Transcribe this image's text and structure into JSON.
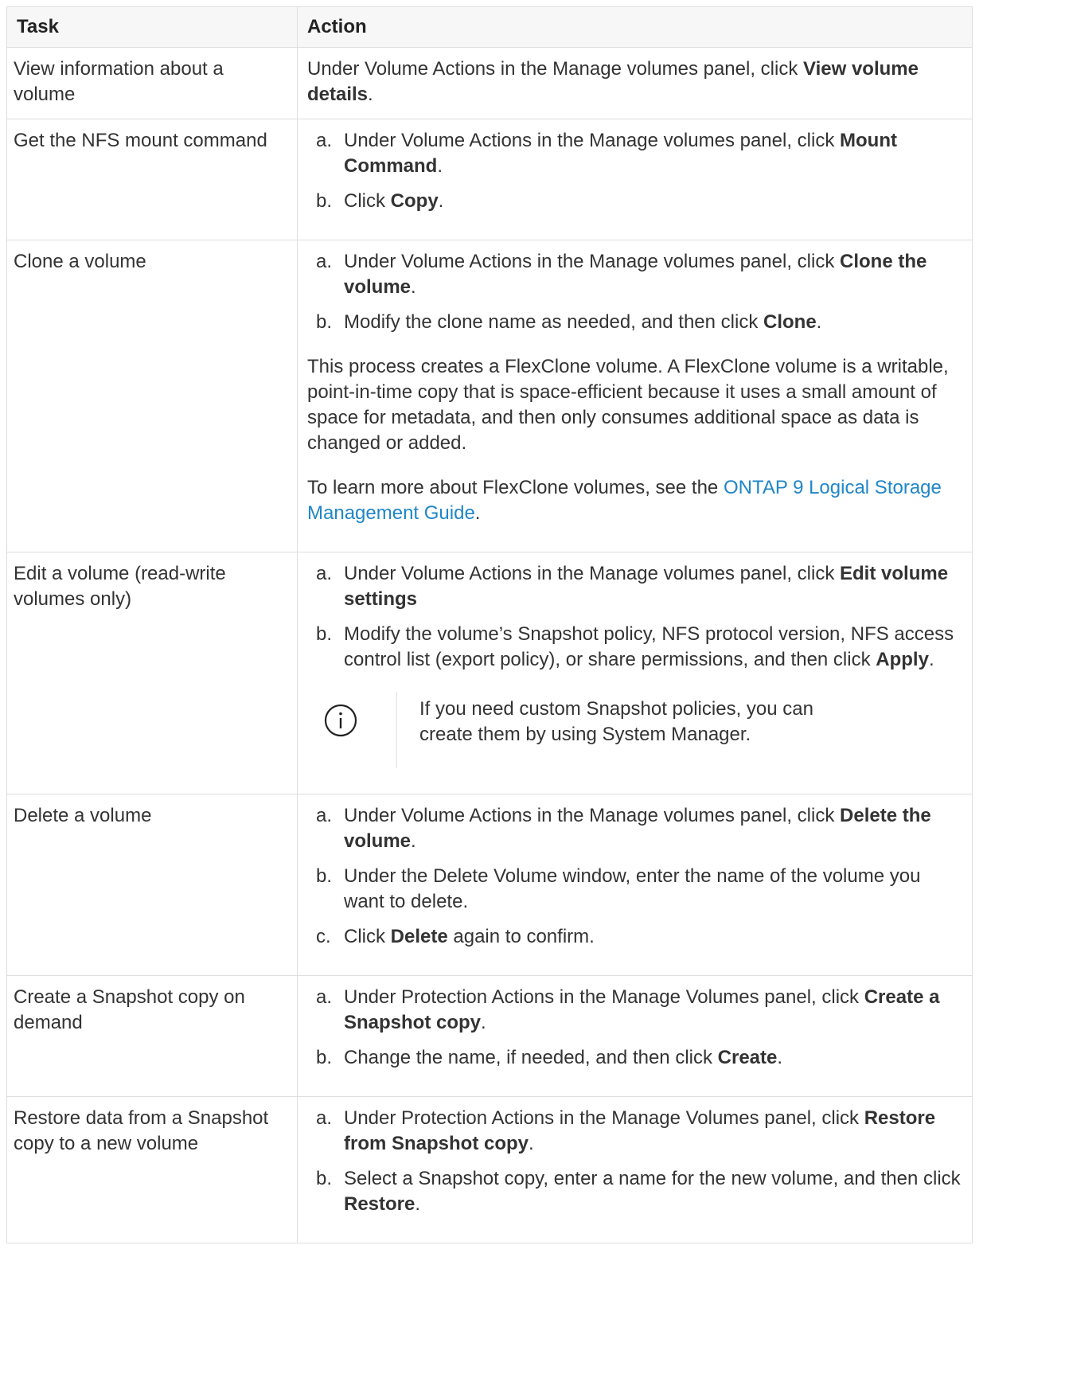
{
  "headers": {
    "task": "Task",
    "action": "Action"
  },
  "rows": [
    {
      "task": "View information about a volume",
      "action": {
        "pre": "Under Volume Actions in the Manage volumes panel, click ",
        "bold": "View volume details",
        "post": "."
      }
    },
    {
      "task": "Get the NFS mount command",
      "steps": [
        {
          "marker": "a.",
          "pre": "Under Volume Actions in the Manage volumes panel, click ",
          "bold": "Mount Command",
          "post": "."
        },
        {
          "marker": "b.",
          "pre": "Click ",
          "bold": "Copy",
          "post": "."
        }
      ]
    },
    {
      "task": "Clone a volume",
      "steps": [
        {
          "marker": "a.",
          "pre": "Under Volume Actions in the Manage volumes panel, click ",
          "bold": "Clone the volume",
          "post": "."
        },
        {
          "marker": "b.",
          "pre": "Modify the clone name as needed, and then click ",
          "bold": "Clone",
          "post": "."
        }
      ],
      "paragraph": "This process creates a FlexClone volume. A FlexClone volume is a writable, point-in-time copy that is space-efficient because it uses a small amount of space for metadata, and then only consumes additional space as data is changed or added.",
      "learn_more": {
        "pre": "To learn more about FlexClone volumes, see the ",
        "link": "ONTAP 9 Logical Storage Management Guide",
        "post": "."
      }
    },
    {
      "task": "Edit a volume (read-write volumes only)",
      "steps": [
        {
          "marker": "a.",
          "pre": "Under Volume Actions in the Manage volumes panel, click ",
          "bold": "Edit volume settings",
          "post": ""
        },
        {
          "marker": "b.",
          "pre": "Modify the volume’s Snapshot policy, NFS protocol version, NFS access control list (export policy), or share permissions, and then click ",
          "bold": "Apply",
          "post": "."
        }
      ],
      "note": {
        "icon": "info-icon",
        "text": "If you need custom Snapshot policies, you can create them by using System Manager."
      }
    },
    {
      "task": "Delete a volume",
      "steps": [
        {
          "marker": "a.",
          "pre": "Under Volume Actions in the Manage volumes panel, click ",
          "bold": "Delete the volume",
          "post": "."
        },
        {
          "marker": "b.",
          "pre": "Under the Delete Volume window, enter the name of the volume you want to delete.",
          "bold": "",
          "post": ""
        },
        {
          "marker": "c.",
          "pre": "Click ",
          "bold": "Delete",
          "post": " again to confirm."
        }
      ]
    },
    {
      "task": "Create a Snapshot copy on demand",
      "steps": [
        {
          "marker": "a.",
          "pre": "Under Protection Actions in the Manage Volumes panel, click ",
          "bold": "Create a Snapshot copy",
          "post": "."
        },
        {
          "marker": "b.",
          "pre": "Change the name, if needed, and then click ",
          "bold": "Create",
          "post": "."
        }
      ]
    },
    {
      "task": "Restore data from a Snapshot copy to a new volume",
      "steps": [
        {
          "marker": "a.",
          "pre": "Under Protection Actions in the Manage Volumes panel, click ",
          "bold": "Restore from Snapshot copy",
          "post": "."
        },
        {
          "marker": "b.",
          "pre": "Select a Snapshot copy, enter a name for the new volume, and then click ",
          "bold": "Restore",
          "post": "."
        }
      ]
    }
  ],
  "colors": {
    "link": "#1f86c8",
    "border": "#dedede",
    "header_bg": "#f7f7f8",
    "text": "#333333"
  }
}
